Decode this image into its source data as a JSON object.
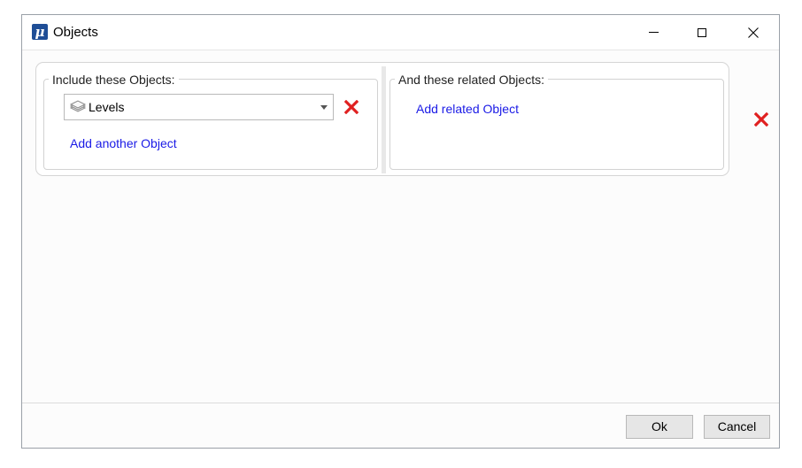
{
  "window": {
    "title": "Objects",
    "app_icon": "microstation-mu-icon",
    "accent_color": "#1f4e96"
  },
  "title_buttons": {
    "minimize": "minimize-icon",
    "maximize": "maximize-icon",
    "close": "close-icon"
  },
  "include_group": {
    "legend": "Include these Objects:",
    "object_select": {
      "value": "Levels",
      "icon": "levels-stack-icon"
    },
    "remove_icon": "red-x-icon",
    "add_link": "Add another Object"
  },
  "related_group": {
    "legend": "And these related Objects:",
    "add_link": "Add related Object"
  },
  "remove_group_icon": "red-x-icon",
  "footer": {
    "ok_label": "Ok",
    "cancel_label": "Cancel"
  },
  "colors": {
    "link": "#1a1ae6",
    "delete_red": "#e02020"
  }
}
